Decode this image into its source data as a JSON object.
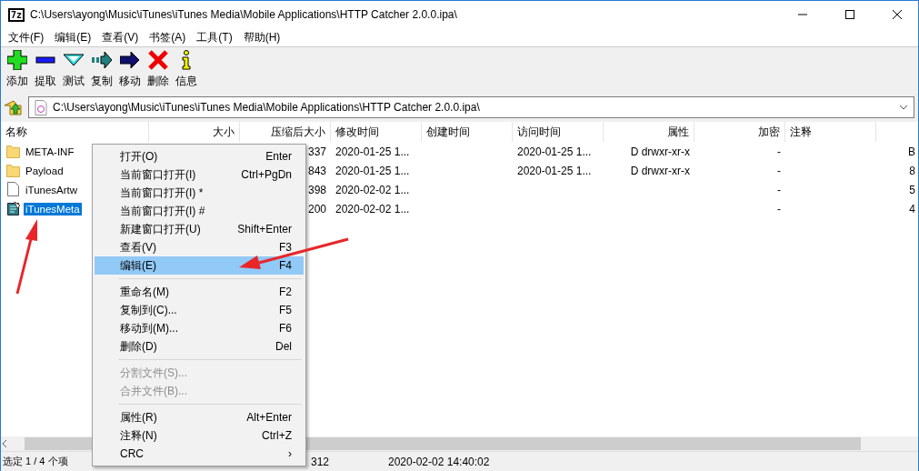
{
  "window": {
    "logo": "7z",
    "title": "C:\\Users\\ayong\\Music\\iTunes\\iTunes Media\\Mobile Applications\\HTTP Catcher 2.0.0.ipa\\"
  },
  "menu_bar": [
    "文件(F)",
    "编辑(E)",
    "查看(V)",
    "书签(A)",
    "工具(T)",
    "帮助(H)"
  ],
  "toolbar": [
    {
      "kind": "add",
      "label": "添加"
    },
    {
      "kind": "extract",
      "label": "提取"
    },
    {
      "kind": "test",
      "label": "测试"
    },
    {
      "kind": "copy",
      "label": "复制"
    },
    {
      "kind": "move",
      "label": "移动"
    },
    {
      "kind": "delete",
      "label": "删除"
    },
    {
      "kind": "info",
      "label": "信息"
    }
  ],
  "address": {
    "value": "C:\\Users\\ayong\\Music\\iTunes\\iTunes Media\\Mobile Applications\\HTTP Catcher 2.0.0.ipa\\"
  },
  "table": {
    "columns": [
      {
        "label": "名称"
      },
      {
        "label": "大小"
      },
      {
        "label": "压缩后大小"
      },
      {
        "label": "修改时间"
      },
      {
        "label": "创建时间"
      },
      {
        "label": "访问时间"
      },
      {
        "label": "属性"
      },
      {
        "label": "加密"
      },
      {
        "label": "注释"
      },
      {}
    ],
    "rows": [
      {
        "kind": "folder",
        "selected": false,
        "cells": [
          "META-INF",
          "",
          "337",
          "2020-01-25 1...",
          "",
          "2020-01-25 1...",
          "D drwxr-xr-x",
          "-",
          "",
          "B"
        ]
      },
      {
        "kind": "folder",
        "selected": false,
        "cells": [
          "Payload",
          "",
          "843",
          "2020-01-25 1...",
          "",
          "2020-01-25 1...",
          "D drwxr-xr-x",
          "-",
          "",
          "8"
        ]
      },
      {
        "kind": "file",
        "selected": false,
        "cells": [
          "iTunesArtw",
          "",
          "398",
          "2020-02-02 1...",
          "",
          "",
          "",
          "-",
          "",
          "5"
        ]
      },
      {
        "kind": "plist",
        "selected": true,
        "cells": [
          "iTunesMeta",
          "",
          "200",
          "2020-02-02 1...",
          "",
          "",
          "",
          "-",
          "",
          "4"
        ]
      }
    ]
  },
  "status_bar": [
    "选定 1 / 4 个项",
    "312",
    "2020-02-02 14:40:02"
  ],
  "context_menu": [
    {
      "kind": "item",
      "label": "打开(O)",
      "shortcut": "Enter",
      "selected": false,
      "disabled": false
    },
    {
      "kind": "item",
      "label": "当前窗口打开(I)",
      "shortcut": "Ctrl+PgDn",
      "selected": false,
      "disabled": false
    },
    {
      "kind": "item",
      "label": "当前窗口打开(I) *",
      "selected": false,
      "disabled": false
    },
    {
      "kind": "item",
      "label": "当前窗口打开(I) #",
      "selected": false,
      "disabled": false
    },
    {
      "kind": "item",
      "label": "新建窗口打开(U)",
      "shortcut": "Shift+Enter",
      "selected": false,
      "disabled": false
    },
    {
      "kind": "item",
      "label": "查看(V)",
      "shortcut": "F3",
      "selected": false,
      "disabled": false
    },
    {
      "kind": "item",
      "label": "编辑(E)",
      "shortcut": "F4",
      "selected": true,
      "disabled": false
    },
    {
      "kind": "separator"
    },
    {
      "kind": "item",
      "label": "重命名(M)",
      "shortcut": "F2",
      "selected": false,
      "disabled": false
    },
    {
      "kind": "item",
      "label": "复制到(C)...",
      "shortcut": "F5",
      "selected": false,
      "disabled": false
    },
    {
      "kind": "item",
      "label": "移动到(M)...",
      "shortcut": "F6",
      "selected": false,
      "disabled": false
    },
    {
      "kind": "item",
      "label": "删除(D)",
      "shortcut": "Del",
      "selected": false,
      "disabled": false
    },
    {
      "kind": "separator"
    },
    {
      "kind": "item",
      "label": "分割文件(S)...",
      "selected": false,
      "disabled": true
    },
    {
      "kind": "item",
      "label": "合并文件(B)...",
      "selected": false,
      "disabled": true
    },
    {
      "kind": "separator"
    },
    {
      "kind": "item",
      "label": "属性(R)",
      "shortcut": "Alt+Enter",
      "selected": false,
      "disabled": false
    },
    {
      "kind": "item",
      "label": "注释(N)",
      "shortcut": "Ctrl+Z",
      "selected": false,
      "disabled": false
    },
    {
      "kind": "item",
      "label": "CRC",
      "submenu": "›",
      "selected": false,
      "disabled": false
    }
  ]
}
